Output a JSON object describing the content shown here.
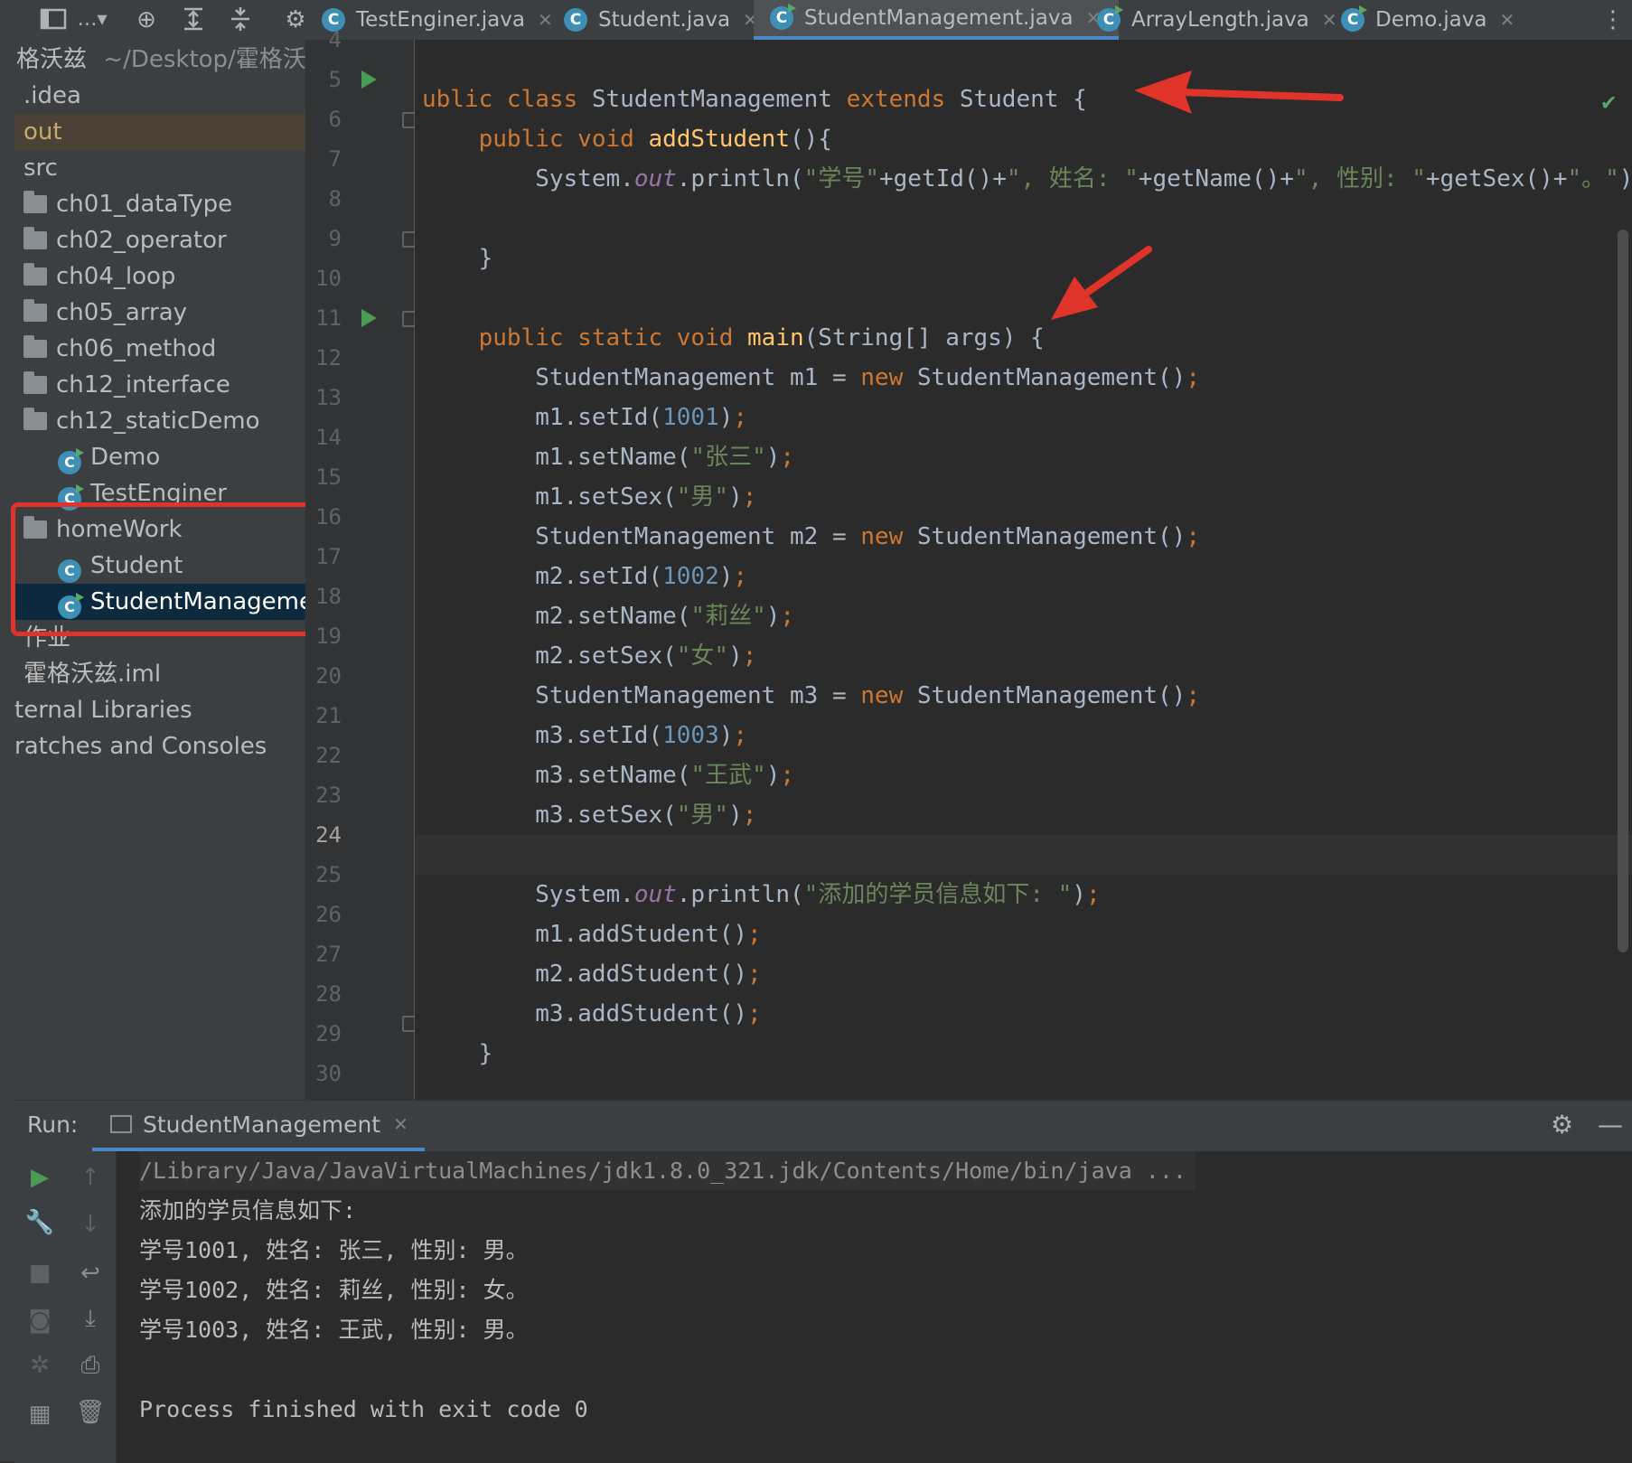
{
  "tabs": [
    {
      "label": "TestEnginer.java",
      "active": false
    },
    {
      "label": "Student.java",
      "active": false
    },
    {
      "label": "StudentManagement.java",
      "active": true
    },
    {
      "label": "ArrayLength.java",
      "active": false
    },
    {
      "label": "Demo.java",
      "active": false
    }
  ],
  "project": {
    "root_name": "格沃兹",
    "root_path": "~/Desktop/霍格沃兹",
    "items": [
      {
        "label": ".idea"
      },
      {
        "label": "out"
      },
      {
        "label": "src"
      },
      {
        "label": "ch01_dataType"
      },
      {
        "label": "ch02_operator"
      },
      {
        "label": "ch04_loop"
      },
      {
        "label": "ch05_array"
      },
      {
        "label": "ch06_method"
      },
      {
        "label": "ch12_interface"
      },
      {
        "label": "ch12_staticDemo"
      },
      {
        "label": "Demo"
      },
      {
        "label": "TestEnginer"
      },
      {
        "label": "homeWork"
      },
      {
        "label": "Student"
      },
      {
        "label": "StudentManagemen"
      },
      {
        "label": "作业"
      },
      {
        "label": "霍格沃兹.iml"
      },
      {
        "label": "ternal Libraries"
      },
      {
        "label": "ratches and Consoles"
      }
    ]
  },
  "editor": {
    "line_numbers": [
      "4",
      "5",
      "6",
      "7",
      "8",
      "9",
      "10",
      "11",
      "12",
      "13",
      "14",
      "15",
      "16",
      "17",
      "18",
      "19",
      "20",
      "21",
      "22",
      "23",
      "24",
      "25",
      "26",
      "27",
      "28",
      "29",
      "30"
    ],
    "current_line": "24",
    "code": {
      "l5_a": "ublic ",
      "l5_b": "class ",
      "l5_c": "StudentManagement ",
      "l5_d": "extends ",
      "l5_e": "Student {",
      "l6_a": "    public void ",
      "l6_b": "addStudent",
      "l6_c": "(){",
      "l7_a": "        System.",
      "l7_b": "out",
      "l7_c": ".println(",
      "l7_d": "\"学号\"",
      "l7_e": "+getId()+",
      "l7_f": "\", 姓名: \"",
      "l7_g": "+getName()+",
      "l7_h": "\", 性别: \"",
      "l7_i": "+getSex()+",
      "l7_j": "\"。\"",
      "l7_k": ");",
      "l9": "    }",
      "l11_a": "    public static void ",
      "l11_b": "main",
      "l11_c": "(String[] args) {",
      "l12_a": "        StudentManagement m1 = ",
      "l12_b": "new ",
      "l12_c": "StudentManagement()",
      "l12_d": ";",
      "l13_a": "        m1.setId(",
      "l13_b": "1001",
      "l13_c": ")",
      "l13_d": ";",
      "l14_a": "        m1.setName(",
      "l14_b": "\"张三\"",
      "l14_c": ")",
      "l14_d": ";",
      "l15_a": "        m1.setSex(",
      "l15_b": "\"男\"",
      "l15_c": ")",
      "l15_d": ";",
      "l16_a": "        StudentManagement m2 = ",
      "l16_b": "new ",
      "l16_c": "StudentManagement()",
      "l16_d": ";",
      "l17_a": "        m2.setId(",
      "l17_b": "1002",
      "l17_c": ")",
      "l17_d": ";",
      "l18_a": "        m2.setName(",
      "l18_b": "\"莉丝\"",
      "l18_c": ")",
      "l18_d": ";",
      "l19_a": "        m2.setSex(",
      "l19_b": "\"女\"",
      "l19_c": ")",
      "l19_d": ";",
      "l20_a": "        StudentManagement m3 = ",
      "l20_b": "new ",
      "l20_c": "StudentManagement()",
      "l20_d": ";",
      "l21_a": "        m3.setId(",
      "l21_b": "1003",
      "l21_c": ")",
      "l21_d": ";",
      "l22_a": "        m3.setName(",
      "l22_b": "\"王武\"",
      "l22_c": ")",
      "l22_d": ";",
      "l23_a": "        m3.setSex(",
      "l23_b": "\"男\"",
      "l23_c": ")",
      "l23_d": ";",
      "l25_a": "        System.",
      "l25_b": "out",
      "l25_c": ".println(",
      "l25_d": "\"添加的学员信息如下: \"",
      "l25_e": ")",
      "l25_f": ";",
      "l26_a": "        m1.addStudent()",
      "l26_b": ";",
      "l27_a": "        m2.addStudent()",
      "l27_b": ";",
      "l28_a": "        m3.addStudent()",
      "l28_b": ";",
      "l29": "    }"
    }
  },
  "run": {
    "label": "Run:",
    "tab": "StudentManagement",
    "output": [
      "/Library/Java/JavaVirtualMachines/jdk1.8.0_321.jdk/Contents/Home/bin/java ...",
      "添加的学员信息如下:",
      "学号1001, 姓名: 张三, 性别: 男。",
      "学号1002, 姓名: 莉丝, 性别: 女。",
      "学号1003, 姓名: 王武, 性别: 男。",
      "",
      "Process finished with exit code 0"
    ]
  },
  "colors": {
    "accent": "#4a88c7",
    "annotation": "#e0332a",
    "run_green": "#499c54"
  },
  "icons": [
    "project-view-icon",
    "locate-icon",
    "expand-all-icon",
    "collapse-all-icon",
    "settings-icon",
    "run-icon",
    "wrench-icon",
    "stop-icon",
    "camera-icon",
    "bug-icon",
    "layout-icon",
    "up-arrow-icon",
    "down-arrow-icon",
    "soft-wrap-icon",
    "scroll-to-end-icon",
    "print-icon",
    "trash-icon",
    "minimize-icon",
    "checkmark-icon"
  ]
}
